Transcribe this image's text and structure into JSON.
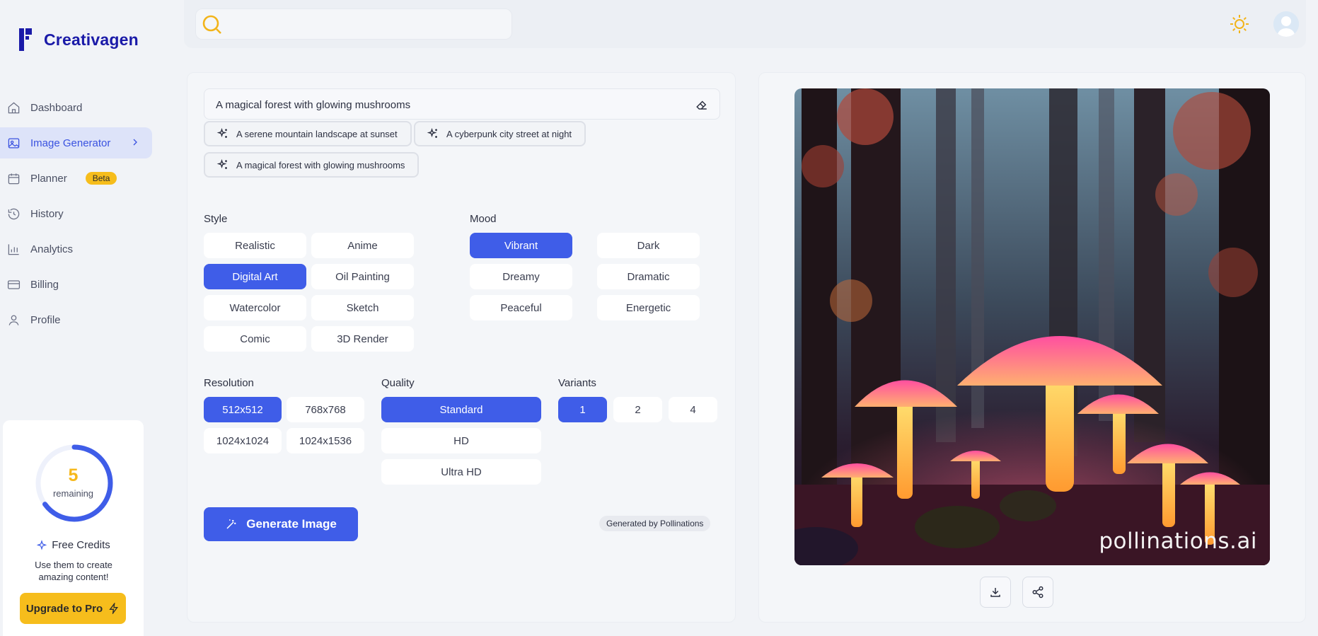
{
  "brand": {
    "name": "Creativagen"
  },
  "sidebar": {
    "items": [
      {
        "label": "Dashboard",
        "icon": "home-icon"
      },
      {
        "label": "Image Generator",
        "icon": "image-icon",
        "active": true
      },
      {
        "label": "Planner",
        "icon": "calendar-icon",
        "badge": "Beta"
      },
      {
        "label": "History",
        "icon": "history-icon"
      },
      {
        "label": "Analytics",
        "icon": "bar-chart-icon"
      },
      {
        "label": "Billing",
        "icon": "credit-card-icon"
      },
      {
        "label": "Profile",
        "icon": "user-icon"
      }
    ]
  },
  "credits": {
    "remaining": "5",
    "remaining_label": "remaining",
    "progress_fraction": 0.65,
    "title": "Free Credits",
    "description": "Use them to create amazing content!",
    "upgrade_label": "Upgrade to Pro"
  },
  "topbar": {
    "search_placeholder": ""
  },
  "form": {
    "prompt_value": "A magical forest with glowing mushrooms",
    "suggestions": [
      "A serene mountain landscape at sunset",
      "A cyberpunk city street at night",
      "A magical forest with glowing mushrooms"
    ],
    "style": {
      "label": "Style",
      "options": [
        "Realistic",
        "Anime",
        "Digital Art",
        "Oil Painting",
        "Watercolor",
        "Sketch",
        "Comic",
        "3D Render"
      ],
      "selected": "Digital Art"
    },
    "mood": {
      "label": "Mood",
      "options": [
        "Vibrant",
        "Dark",
        "Dreamy",
        "Dramatic",
        "Peaceful",
        "Energetic"
      ],
      "selected": "Vibrant"
    },
    "resolution": {
      "label": "Resolution",
      "options": [
        "512x512",
        "768x768",
        "1024x1024",
        "1024x1536"
      ],
      "selected": "512x512"
    },
    "quality": {
      "label": "Quality",
      "options": [
        "Standard",
        "HD",
        "Ultra HD"
      ],
      "selected": "Standard"
    },
    "variants": {
      "label": "Variants",
      "options": [
        "1",
        "2",
        "4"
      ],
      "selected": "1"
    },
    "generate_label": "Generate Image",
    "generated_by": "Generated by Pollinations"
  },
  "preview": {
    "watermark": "pollinations.ai",
    "actions": [
      "download-icon",
      "share-icon"
    ]
  },
  "colors": {
    "accent": "#3f5de8",
    "brand": "#1a1aa8",
    "highlight": "#f6bd1c"
  }
}
